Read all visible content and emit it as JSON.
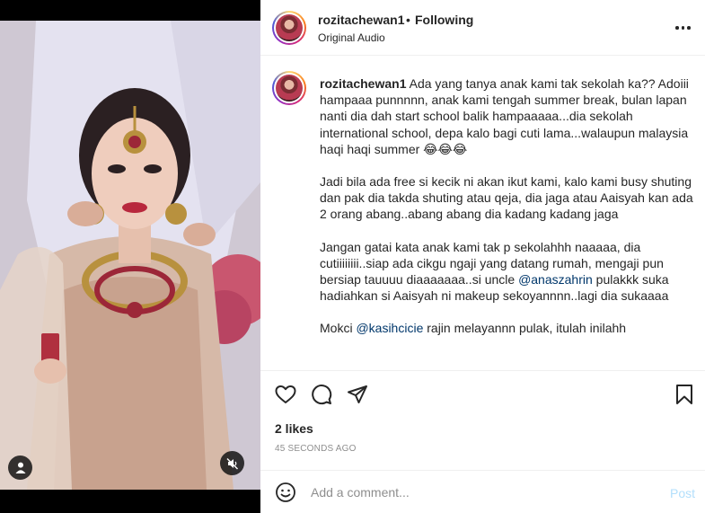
{
  "header": {
    "username": "rozitachewan1",
    "separator": "•",
    "follow_status": "Following",
    "audio": "Original Audio"
  },
  "caption": {
    "username": "rozitachewan1",
    "paragraph1": "Ada yang tanya anak kami tak sekolah ka?? Adoiii hampaaa punnnnn, anak kami tengah summer break, bulan lapan nanti dia dah start school balik hampaaaaa...dia sekolah international school, depa kalo bagi cuti lama...walaupun malaysia haqi haqi summer 😂😂😂",
    "paragraph2": "Jadi bila ada free si kecik ni akan ikut kami, kalo kami busy shuting dan pak dia takda shuting atau qeja, dia jaga atau Aaisyah kan ada 2 orang abang..abang abang dia kadang kadang jaga",
    "paragraph3_before": "Jangan gatai kata anak kami tak p sekolahhh naaaaa, dia cutiiiiiiii..siap ada cikgu ngaji yang datang rumah, mengaji pun bersiap tauuuu diaaaaaaa..si uncle ",
    "paragraph3_mention": "@anaszahrin",
    "paragraph3_after": " pulakkk suka hadiahkan si Aaisyah ni makeup sekoyannnn..lagi dia sukaaaa",
    "paragraph4_before": "Mokci ",
    "paragraph4_mention": "@kasihcicie",
    "paragraph4_after": " rajin melayannn pulak, itulah inilahh"
  },
  "engagement": {
    "likes": "2 likes",
    "timestamp": "45 SECONDS AGO"
  },
  "comment_box": {
    "placeholder": "Add a comment...",
    "post_label": "Post"
  },
  "icons": {
    "like": "heart-icon",
    "comment": "speech-bubble-icon",
    "share": "paper-plane-icon",
    "save": "bookmark-icon",
    "more": "more-options-icon",
    "emoji": "smiley-icon",
    "media_user": "user-icon",
    "media_mute": "speaker-muted-icon"
  },
  "colors": {
    "text": "#262626",
    "secondary": "#8e8e8e",
    "mention": "#00376b",
    "post_disabled": "#b2dffc"
  }
}
